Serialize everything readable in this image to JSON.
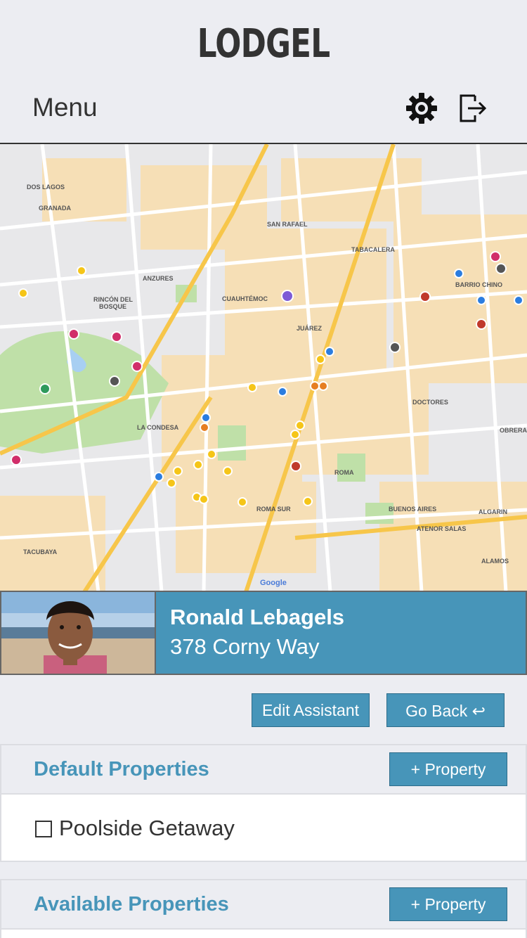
{
  "app": {
    "title": "LODGEL"
  },
  "header": {
    "menu_label": "Menu",
    "settings_icon": "gear-icon",
    "logout_icon": "logout-icon"
  },
  "map": {
    "labels": [
      "DOS LAGOS",
      "GRANADA",
      "SAN RAFAEL",
      "TABACALERA",
      "ANZURES",
      "CUAUHTÉMOC",
      "RINCÓN DEL BOSQUE",
      "JUÁREZ",
      "BARRIO CHINO",
      "LA CONDESA",
      "DOCTORES",
      "OBRERA",
      "ROMA",
      "BUENOS AIRES",
      "ROMA SUR",
      "ALGARIN",
      "ATENOR SALAS",
      "TACUBAYA",
      "ALAMOS",
      "Google"
    ]
  },
  "profile": {
    "name": "Ronald Lebagels",
    "address": "378 Corny Way"
  },
  "actions": {
    "edit_label": "Edit Assistant",
    "back_label": "Go Back ↩"
  },
  "default_section": {
    "title": "Default Properties",
    "add_label": "+ Property",
    "items": [
      {
        "label": "Poolside Getaway",
        "checked": false
      }
    ]
  },
  "available_section": {
    "title": "Available Properties",
    "add_label": "+ Property"
  },
  "colors": {
    "accent": "#4795b9",
    "background": "#ecedf2",
    "text": "#333333"
  }
}
